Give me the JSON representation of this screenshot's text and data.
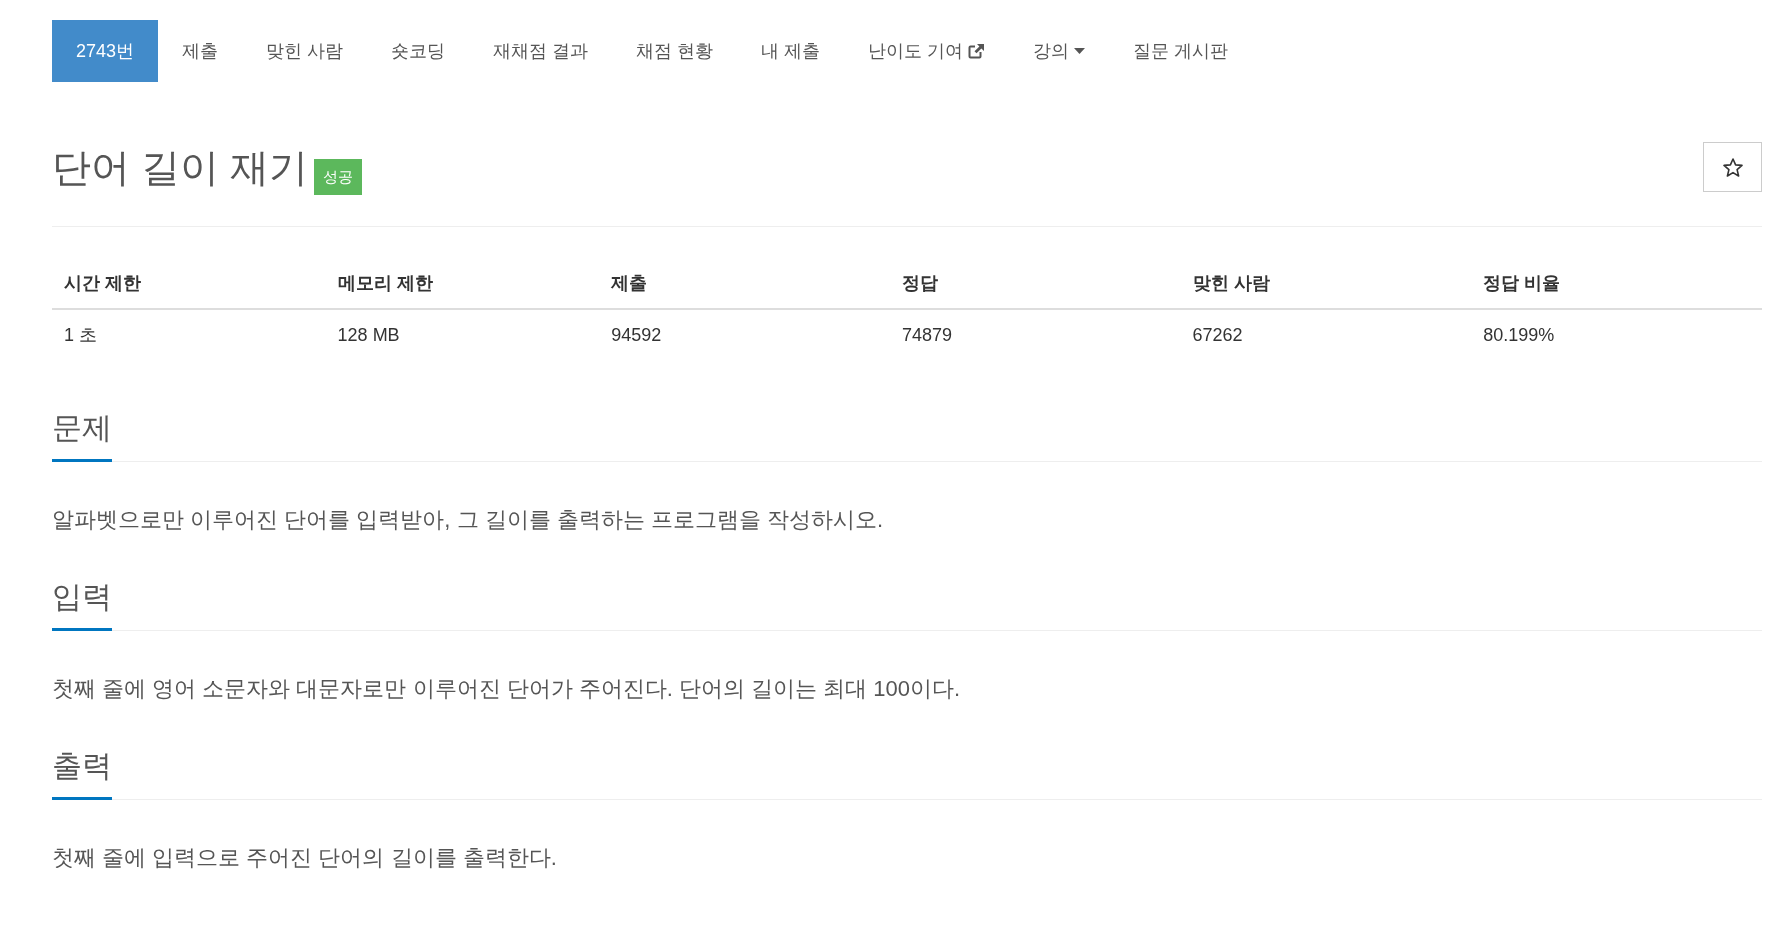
{
  "nav": {
    "tabs": [
      {
        "label": "2743번",
        "selected": true,
        "kind": "link"
      },
      {
        "label": "제출",
        "selected": false,
        "kind": "link"
      },
      {
        "label": "맞힌 사람",
        "selected": false,
        "kind": "link"
      },
      {
        "label": "숏코딩",
        "selected": false,
        "kind": "link"
      },
      {
        "label": "재채점 결과",
        "selected": false,
        "kind": "link"
      },
      {
        "label": "채점 현황",
        "selected": false,
        "kind": "link"
      },
      {
        "label": "내 제출",
        "selected": false,
        "kind": "link"
      },
      {
        "label": "난이도 기여",
        "selected": false,
        "kind": "external"
      },
      {
        "label": "강의",
        "selected": false,
        "kind": "dropdown"
      },
      {
        "label": "질문 게시판",
        "selected": false,
        "kind": "link"
      }
    ]
  },
  "problem": {
    "title": "단어 길이 재기",
    "badge": {
      "label": "성공",
      "kind": "success"
    },
    "starred": false
  },
  "info_table": {
    "columns": [
      "시간 제한",
      "메모리 제한",
      "제출",
      "정답",
      "맞힌 사람",
      "정답 비율"
    ],
    "rows": [
      [
        "1 초",
        "128 MB",
        "94592",
        "74879",
        "67262",
        "80.199%"
      ]
    ]
  },
  "sections": [
    {
      "heading": "문제",
      "text": "알파벳으로만 이루어진 단어를 입력받아, 그 길이를 출력하는 프로그램을 작성하시오."
    },
    {
      "heading": "입력",
      "text": "첫째 줄에 영어 소문자와 대문자로만 이루어진 단어가 주어진다. 단어의 길이는 최대 100이다."
    },
    {
      "heading": "출력",
      "text": "첫째 줄에 입력으로 주어진 단어의 길이를 출력한다."
    }
  ]
}
